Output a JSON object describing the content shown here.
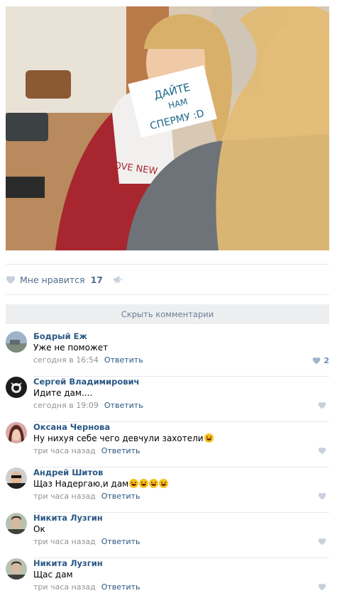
{
  "post": {
    "photo_alt": "",
    "sign_line1": "ДАЙТЕ",
    "sign_line2": "НАМ",
    "sign_line3": "СПЕРМУ :D",
    "shirt_text": "LOVE NEW"
  },
  "actions": {
    "like_label": "Мне нравится",
    "like_count": "17"
  },
  "comments_header": {
    "hide_label": "Скрыть комментарии"
  },
  "comments": [
    {
      "author": "Бодрый Еж",
      "text": "Уже не поможет",
      "time": "сегодня в 16:54",
      "reply": "Ответить",
      "likes": "2"
    },
    {
      "author": "Сергей Владимирович",
      "text": "Идите дам....",
      "time": "сегодня в 19:09",
      "reply": "Ответить",
      "likes": ""
    },
    {
      "author": "Оксана Чернова",
      "text": "Ну нихуя себе чего девчули захотели",
      "time": "три часа назад",
      "reply": "Ответить",
      "likes": ""
    },
    {
      "author": "Андрей Шитов",
      "text": "Щаз Надергаю,и дам",
      "time": "три часа назад",
      "reply": "Ответить",
      "likes": ""
    },
    {
      "author": "Никита Лузгин",
      "text": "Ок",
      "time": "три часа назад",
      "reply": "Ответить",
      "likes": ""
    },
    {
      "author": "Никита Лузгин",
      "text": "Щас дам",
      "time": "три часа назад",
      "reply": "Ответить",
      "likes": ""
    }
  ],
  "colors": {
    "link": "#2a5885",
    "muted": "#939393",
    "like_blue": "#6b8bb0",
    "bar_bg": "#edeef0"
  },
  "icons": {
    "like": "heart-icon",
    "share": "megaphone-icon"
  }
}
